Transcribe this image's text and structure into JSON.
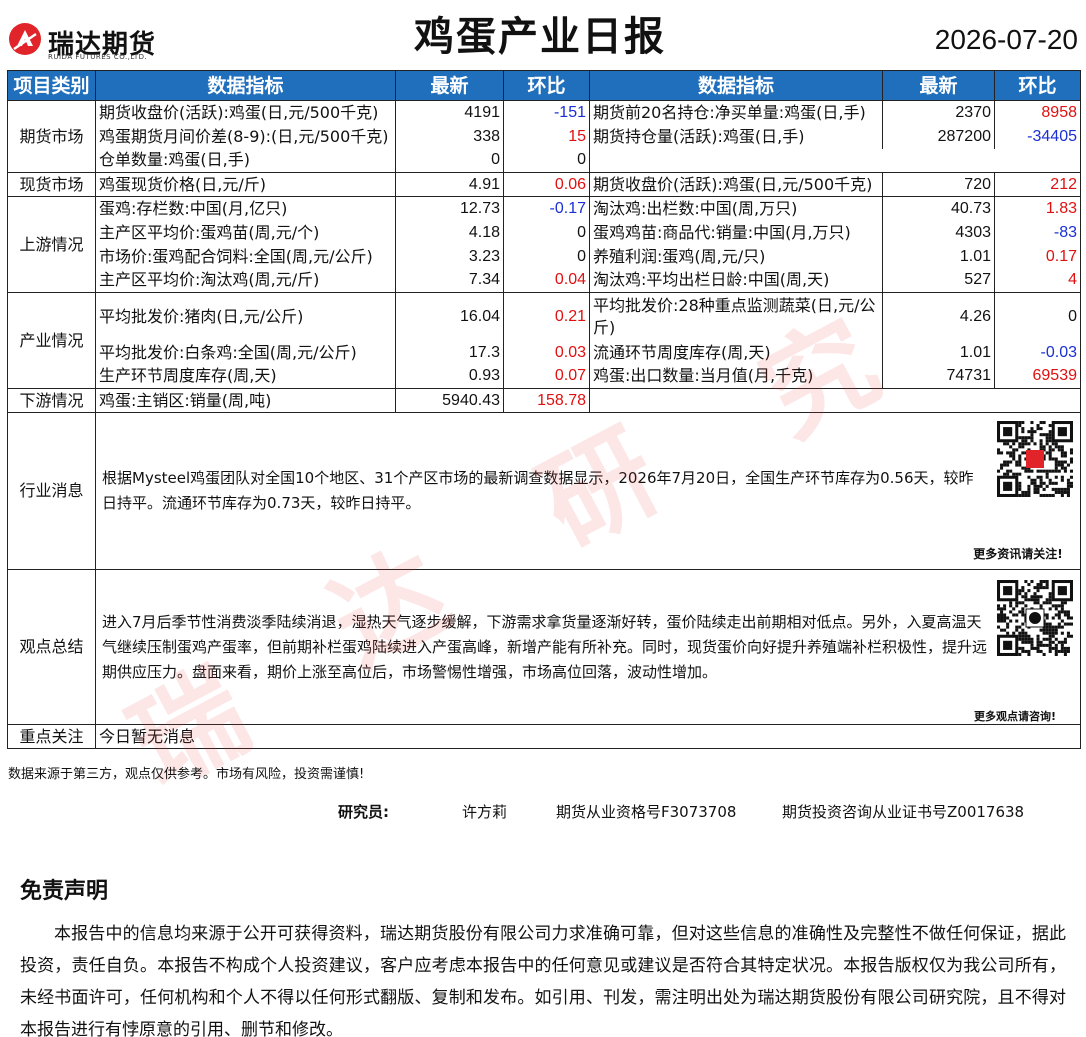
{
  "header": {
    "logo_cn": "瑞达期货",
    "logo_en": "RUIDA FUTURES CO.,LTD.",
    "title": "鸡蛋产业日报",
    "date": "2026-07-20"
  },
  "table_headers": {
    "category": "项目类别",
    "indicator": "数据指标",
    "latest": "最新",
    "change": "环比"
  },
  "sections": {
    "futures": {
      "category": "期货市场",
      "rows": [
        {
          "l_name": "期货收盘价(活跃):鸡蛋(日,元/500千克)",
          "l_val": "4191",
          "l_chg": "-151",
          "r_name": "期货前20名持仓:净买单量:鸡蛋(日,手)",
          "r_val": "2370",
          "r_chg": "8958"
        },
        {
          "l_name": "鸡蛋期货月间价差(8-9):(日,元/500千克)",
          "l_val": "338",
          "l_chg": "15",
          "r_name": "期货持仓量(活跃):鸡蛋(日,手)",
          "r_val": "287200",
          "r_chg": "-34405"
        },
        {
          "l_name": "仓单数量:鸡蛋(日,手)",
          "l_val": "0",
          "l_chg": "0"
        }
      ]
    },
    "spot": {
      "category": "现货市场",
      "rows": [
        {
          "l_name": "鸡蛋现货价格(日,元/斤)",
          "l_val": "4.91",
          "l_chg": "0.06",
          "r_name": "期货收盘价(活跃):鸡蛋(日,元/500千克)",
          "r_val": "720",
          "r_chg": "212"
        }
      ]
    },
    "upstream": {
      "category": "上游情况",
      "rows": [
        {
          "l_name": "蛋鸡:存栏数:中国(月,亿只)",
          "l_val": "12.73",
          "l_chg": "-0.17",
          "r_name": "淘汰鸡:出栏数:中国(周,万只)",
          "r_val": "40.73",
          "r_chg": "1.83"
        },
        {
          "l_name": "主产区平均价:蛋鸡苗(周,元/个)",
          "l_val": "4.18",
          "l_chg": "0",
          "r_name": "蛋鸡鸡苗:商品代:销量:中国(月,万只)",
          "r_val": "4303",
          "r_chg": "-83"
        },
        {
          "l_name": "市场价:蛋鸡配合饲料:全国(周,元/公斤)",
          "l_val": "3.23",
          "l_chg": "0",
          "r_name": "养殖利润:蛋鸡(周,元/只)",
          "r_val": "1.01",
          "r_chg": "0.17"
        },
        {
          "l_name": "主产区平均价:淘汰鸡(周,元/斤)",
          "l_val": "7.34",
          "l_chg": "0.04",
          "r_name": "淘汰鸡:平均出栏日龄:中国(周,天)",
          "r_val": "527",
          "r_chg": "4"
        }
      ]
    },
    "industry": {
      "category": "产业情况",
      "rows": [
        {
          "l_name": "平均批发价:猪肉(日,元/公斤)",
          "l_val": "16.04",
          "l_chg": "0.21",
          "r_name": "平均批发价:28种重点监测蔬菜(日,元/公斤)",
          "r_val": "4.26",
          "r_chg": "0"
        },
        {
          "l_name": "平均批发价:白条鸡:全国(周,元/公斤)",
          "l_val": "17.3",
          "l_chg": "0.03",
          "r_name": "流通环节周度库存(周,天)",
          "r_val": "1.01",
          "r_chg": "-0.03"
        },
        {
          "l_name": "生产环节周度库存(周,天)",
          "l_val": "0.93",
          "l_chg": "0.07",
          "r_name": "鸡蛋:出口数量:当月值(月,千克)",
          "r_val": "74731",
          "r_chg": "69539"
        }
      ]
    },
    "downstream": {
      "category": "下游情况",
      "rows": [
        {
          "l_name": "鸡蛋:主销区:销量(周,吨)",
          "l_val": "5940.43",
          "l_chg": "158.78"
        }
      ]
    }
  },
  "news": {
    "category": "行业消息",
    "text": "根据Mysteel鸡蛋团队对全国10个地区、31个产区市场的最新调查数据显示，2026年7月20日，全国生产环节库存为0.56天，较昨日持平。流通环节库存为0.73天，较昨日持平。",
    "qr_caption": "更多资讯请关注!"
  },
  "view": {
    "category": "观点总结",
    "text": "进入7月后季节性消费淡季陆续消退，湿热天气逐步缓解，下游需求拿货量逐渐好转，蛋价陆续走出前期相对低点。另外，入夏高温天气继续压制蛋鸡产蛋率，但前期补栏蛋鸡陆续进入产蛋高峰，新增产能有所补充。同时，现货蛋价向好提升养殖端补栏积极性，提升远期供应压力。盘面来看，期价上涨至高位后，市场警惕性增强，市场高位回落，波动性增加。",
    "qr_caption": "更多观点请咨询!"
  },
  "focus": {
    "category": "重点关注",
    "text": "今日暂无消息"
  },
  "footer": {
    "note": "数据来源于第三方，观点仅供参考。市场有风险，投资需谨慎!",
    "researcher_label": "研究员:",
    "researcher_name": "许方莉",
    "license1": "期货从业资格号F3073708",
    "license2": "期货投资咨询从业证书号Z0017638"
  },
  "disclaimer": {
    "title": "免责声明",
    "text": "本报告中的信息均来源于公开可获得资料，瑞达期货股份有限公司力求准确可靠，但对这些信息的准确性及完整性不做任何保证，据此投资，责任自负。本报告不构成个人投资建议，客户应考虑本报告中的任何意见或建议是否符合其特定状况。本报告版权仅为我公司所有，未经书面许可，任何机构和个人不得以任何形式翻版、复制和发布。如引用、刊发，需注明出处为瑞达期货股份有限公司研究院，且不得对本报告进行有悖原意的引用、删节和修改。"
  },
  "colors": {
    "header_bg": "#1f6fbd",
    "positive": "#e01010",
    "negative": "#1a2fd6",
    "logo_red": "#e0242a"
  }
}
